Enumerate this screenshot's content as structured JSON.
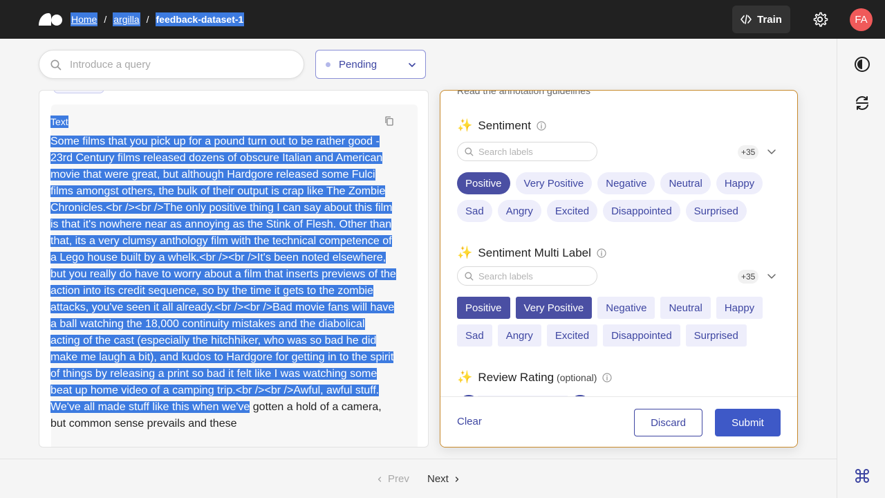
{
  "header": {
    "breadcrumbs": [
      "Home",
      "argilla",
      "feedback-dataset-1"
    ],
    "train_label": "Train",
    "avatar_initials": "FA"
  },
  "toolbar": {
    "search_placeholder": "Introduce a query",
    "search_value": "",
    "status_value": "Pending"
  },
  "record": {
    "field_title": "Text",
    "text_highlighted": "Some films that you pick up for a pound turn out to be rather good - 23rd Century films released dozens of obscure Italian and American movie that were great, but although Hardgore released some Fulci films amongst others, the bulk of their output is crap like The Zombie Chronicles.<br /><br />The only positive thing I can say about this film is that it's nowhere near as annoying as the Stink of Flesh. Other than that, its a very clumsy anthology film with the technical competence of a Lego house built by a whelk.<br /><br />It's been noted elsewhere, but you really do have to worry about a film that inserts previews of the action into its credit sequence, so by the time it gets to the zombie attacks, you've seen it all already.<br /><br />Bad movie fans will have a ball watching the 18,000 continuity mistakes and the diabolical acting of the cast (especially the hitchhiker, who was so bad he did make me laugh a bit), and kudos to Hardgore for getting in to the spirit of things by releasing a print so bad it felt like I was watching some beat up home video of a camping trip.<br /><br />Awful, awful stuff. We've all made stuff like this when we've",
    "text_rest": " gotten a hold of a camera, but common sense prevails and these"
  },
  "annotation": {
    "guidelines_text": "Read the annotation guidelines",
    "questions": [
      {
        "title": "Sentiment",
        "search_placeholder": "Search labels",
        "more_count": "+35",
        "labels": [
          "Positive",
          "Very Positive",
          "Negative",
          "Neutral",
          "Happy",
          "Sad",
          "Angry",
          "Excited",
          "Disappointed",
          "Surprised"
        ],
        "selected": [
          "Positive"
        ]
      },
      {
        "title": "Sentiment Multi Label",
        "search_placeholder": "Search labels",
        "more_count": "+35",
        "labels": [
          "Positive",
          "Very Positive",
          "Negative",
          "Neutral",
          "Happy",
          "Sad",
          "Angry",
          "Excited",
          "Disappointed",
          "Surprised"
        ],
        "selected": [
          "Positive",
          "Very Positive"
        ]
      },
      {
        "title": "Review Rating",
        "optional_label": "(optional)"
      }
    ],
    "clear_label": "Clear",
    "discard_label": "Discard",
    "submit_label": "Submit"
  },
  "pagination": {
    "prev_label": "Prev",
    "next_label": "Next"
  },
  "icons": {
    "theme": "contrast-icon",
    "refresh": "refresh-icon",
    "shortcuts": "command-icon"
  },
  "colors": {
    "topbar": "#212121",
    "accent": "#3e46a2",
    "selected_chip": "#4a4fa3",
    "submit": "#3e59c7",
    "avatar": "#f05a5a",
    "highlight": "#3d7be0"
  }
}
